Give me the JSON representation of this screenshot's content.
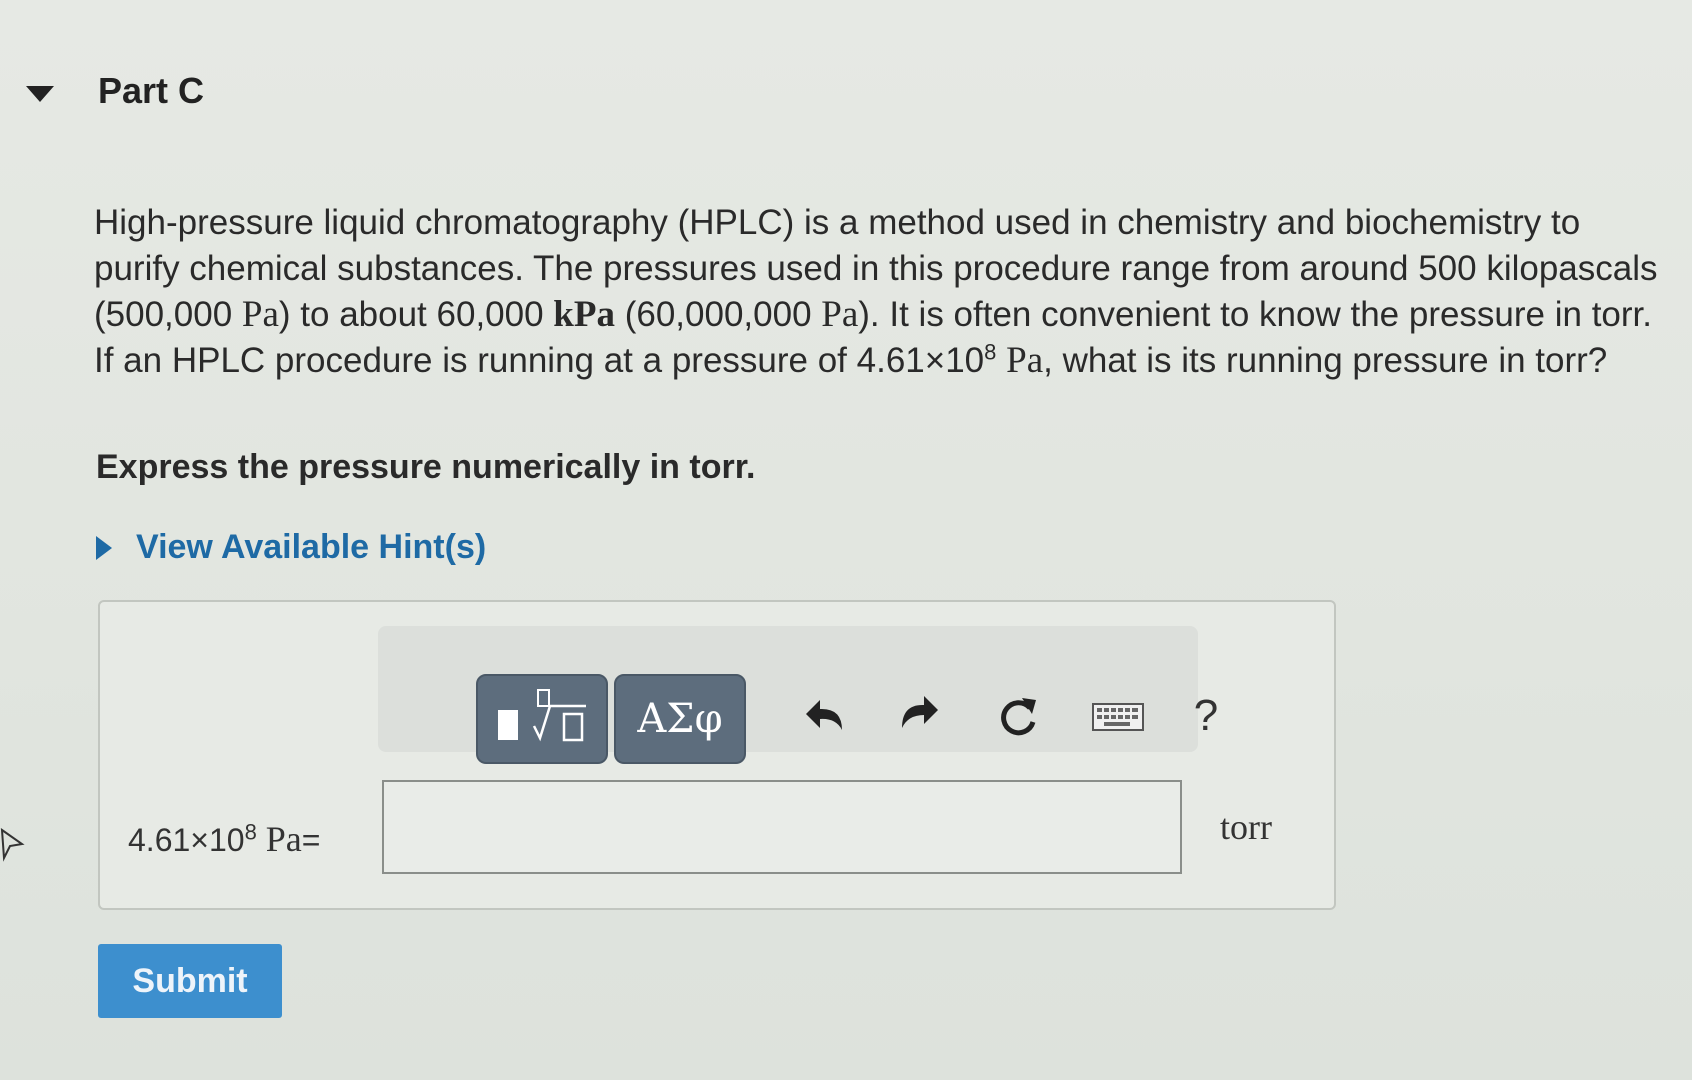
{
  "part": {
    "title": "Part C"
  },
  "question": {
    "s1": "High-pressure liquid chromatography (HPLC) is a method used in chemistry and biochemistry to purify chemical substances. The pressures used in this procedure range from around 500 kilopascals (500,000 ",
    "pa1": "Pa",
    "s2": ") to about 60,000 ",
    "kpa": "kPa",
    "s3": " (60,000,000 ",
    "pa2": "Pa",
    "s4": "). It is often convenient to know the pressure in torr. If an HPLC procedure is running at a pressure of ",
    "val_mant": "4.61×10",
    "val_exp": "8",
    "pa3": "Pa",
    "s5": ", what is its running pressure in torr?"
  },
  "instruction": "Express the pressure numerically in torr.",
  "hint": {
    "label": "View Available Hint(s)"
  },
  "toolbar": {
    "greek_label": "ΑΣφ",
    "help_label": "?",
    "icons": [
      "templates-icon",
      "greek-symbols-icon",
      "undo-icon",
      "redo-icon",
      "reset-icon",
      "keyboard-icon",
      "help-icon"
    ]
  },
  "answer": {
    "lhs_mant": "4.61×10",
    "lhs_exp": "8",
    "lhs_unit": "Pa",
    "equals": "=",
    "value": "",
    "unit": "torr"
  },
  "submit_label": "Submit",
  "colors": {
    "link": "#1e6aa5",
    "submit": "#3d8fce",
    "toolbar_button": "#5d6d7d"
  }
}
